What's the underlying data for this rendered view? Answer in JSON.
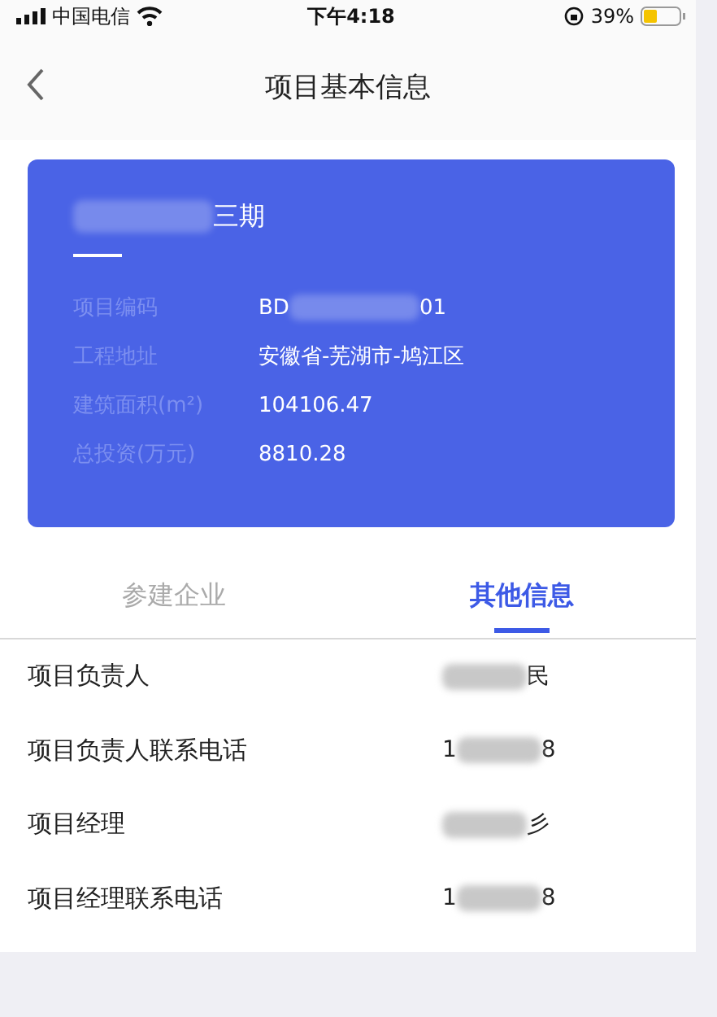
{
  "status_bar": {
    "carrier": "中国电信",
    "time": "下午4:18",
    "battery": "39%"
  },
  "nav": {
    "title": "项目基本信息"
  },
  "project": {
    "title": [
      {
        "kind": "blur"
      },
      {
        "kind": "text",
        "text": "三期"
      }
    ],
    "fields": [
      {
        "label": "项目编码",
        "value": [
          {
            "kind": "text",
            "text": "BD"
          },
          {
            "kind": "blur"
          },
          {
            "kind": "text",
            "text": "01"
          }
        ]
      },
      {
        "label": "工程地址",
        "value": [
          {
            "kind": "text",
            "text": "安徽省-芜湖市-鸠江区"
          }
        ]
      },
      {
        "label": "建筑面积(m²)",
        "value": [
          {
            "kind": "text",
            "text": "104106.47"
          }
        ]
      },
      {
        "label": "总投资(万元)",
        "value": [
          {
            "kind": "text",
            "text": "8810.28"
          }
        ]
      }
    ]
  },
  "tabs": [
    {
      "label": "参建企业",
      "selected": false
    },
    {
      "label": "其他信息",
      "selected": true
    }
  ],
  "rows": [
    {
      "label": "项目负责人",
      "value": [
        {
          "kind": "blur"
        },
        {
          "kind": "text",
          "text": "民"
        }
      ]
    },
    {
      "label": "项目负责人联系电话",
      "value": [
        {
          "kind": "text",
          "text": "1"
        },
        {
          "kind": "blur"
        },
        {
          "kind": "text",
          "text": "8"
        }
      ]
    },
    {
      "label": "项目经理",
      "value": [
        {
          "kind": "blur"
        },
        {
          "kind": "text",
          "text": "彡"
        }
      ]
    },
    {
      "label": "项目经理联系电话",
      "value": [
        {
          "kind": "text",
          "text": "1"
        },
        {
          "kind": "blur"
        },
        {
          "kind": "text",
          "text": "8"
        }
      ]
    }
  ]
}
